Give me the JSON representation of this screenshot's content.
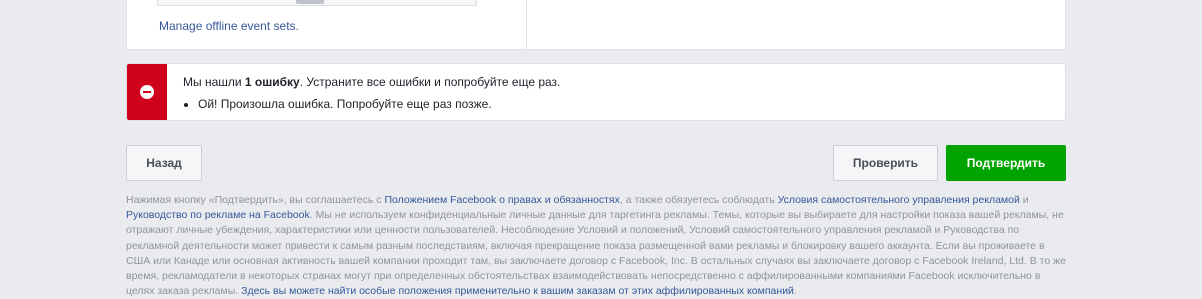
{
  "panel": {
    "manage_link": "Manage offline event sets."
  },
  "error": {
    "summary_pre": "Мы нашли ",
    "summary_bold": "1 ошибку",
    "summary_post": ". Устраните все ошибки и попробуйте еще раз.",
    "items": [
      "Ой! Произошла ошибка. Попробуйте еще раз позже."
    ]
  },
  "buttons": {
    "back": "Назад",
    "review": "Проверить",
    "confirm": "Подтвердить"
  },
  "legal": {
    "t1": "Нажимая кнопку «Подтвердить», вы соглашаетесь с ",
    "link1": "Положением Facebook о правах и обязанностях",
    "t2": ", а также обязуетесь соблюдать ",
    "link2": "Условия самостоятельного управления рекламой",
    "t3": " и ",
    "link3": "Руководство по рекламе на Facebook",
    "t4": ". Мы не используем конфиденциальные личные данные для таргетинга рекламы. Темы, которые вы выбираете для настройки показа вашей рекламы, не отражают личные убеждения, характеристики или ценности пользователей. Несоблюдение Условий и положений, Условий самостоятельного управления рекламой и Руководства по рекламной деятельности может привести к самым разным последствиям, включая прекращение показа размещенной вами рекламы и блокировку вашего аккаунта. Если вы проживаете в США или Канаде или основная активность вашей компании проходит там, вы заключаете договор с Facebook, Inc. В остальных случаях вы заключаете договор с Facebook Ireland, Ltd. В то же время, рекламодатели в некоторых странах могут при определенных обстоятельствах взаимодействовать непосредственно с аффилированными компаниями Facebook исключительно в целях заказа рекламы. ",
    "link4": "Здесь вы можете найти особые положения применительно к вашим заказам от этих аффилированных компаний",
    "t5": "."
  }
}
